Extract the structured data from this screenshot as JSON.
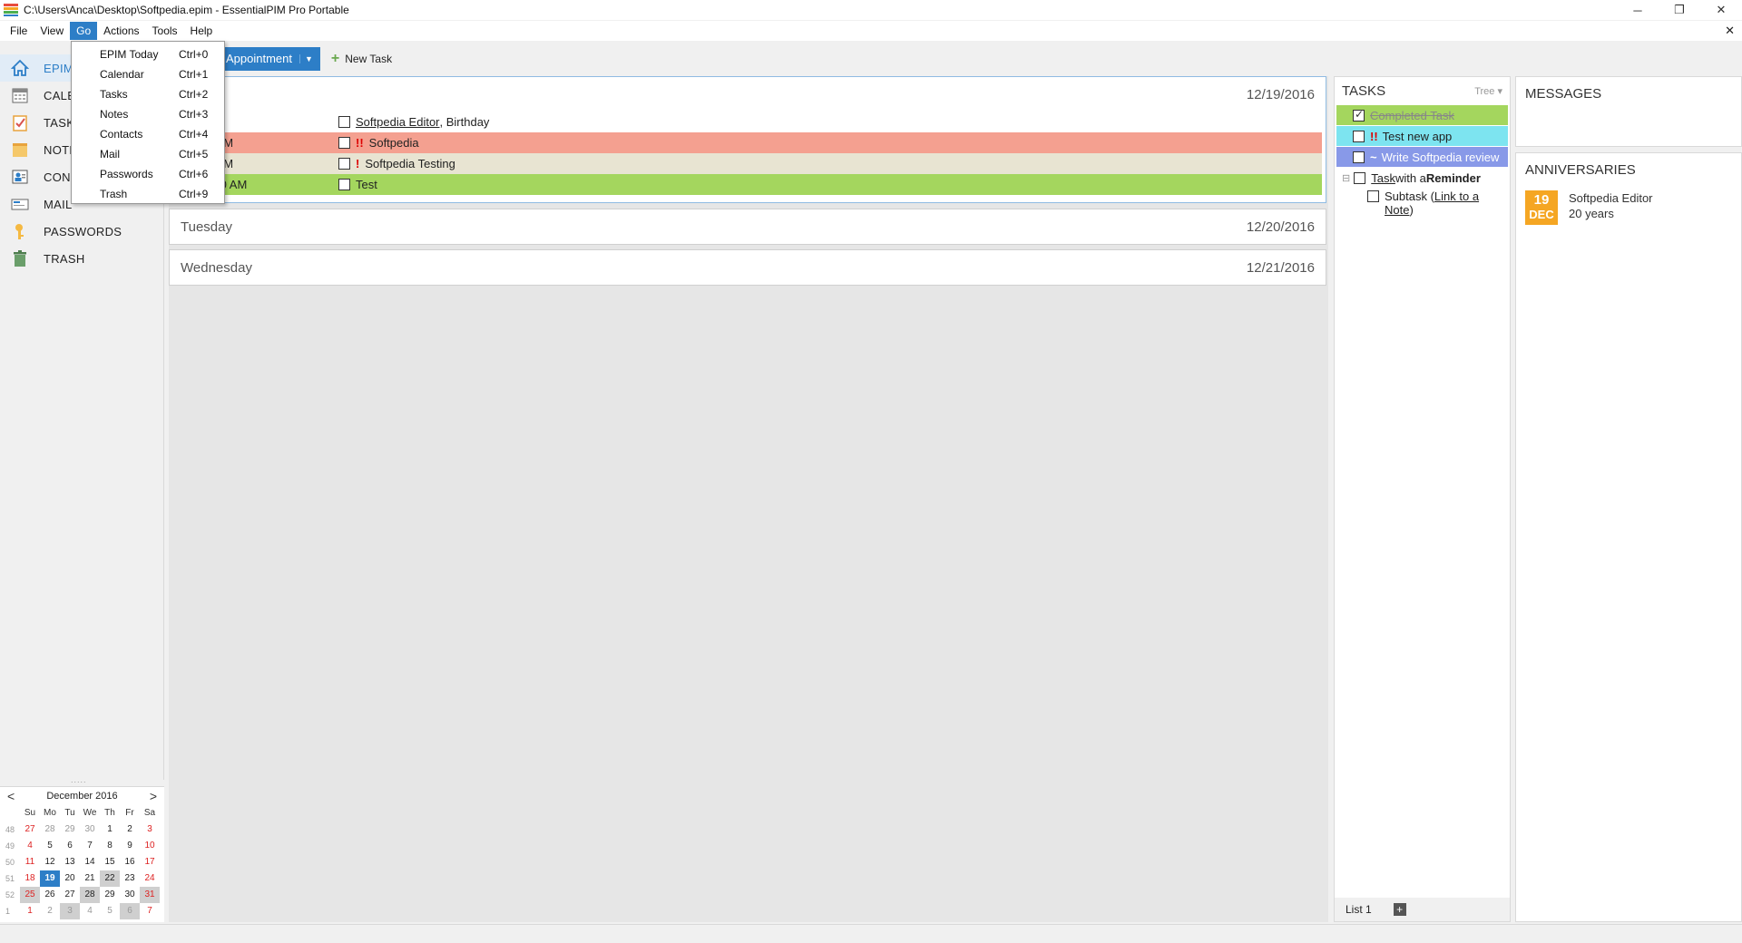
{
  "window": {
    "title": "C:\\Users\\Anca\\Desktop\\Softpedia.epim - EssentialPIM Pro Portable",
    "minimize": "─",
    "restore": "❐",
    "close": "✕",
    "doc_close": "✕"
  },
  "menu": {
    "items": [
      "File",
      "View",
      "Go",
      "Actions",
      "Tools",
      "Help"
    ],
    "active": "Go"
  },
  "go_menu": [
    {
      "label": "EPIM Today",
      "shortcut": "Ctrl+0"
    },
    {
      "label": "Calendar",
      "shortcut": "Ctrl+1"
    },
    {
      "label": "Tasks",
      "shortcut": "Ctrl+2"
    },
    {
      "label": "Notes",
      "shortcut": "Ctrl+3"
    },
    {
      "label": "Contacts",
      "shortcut": "Ctrl+4"
    },
    {
      "label": "Mail",
      "shortcut": "Ctrl+5"
    },
    {
      "label": "Passwords",
      "shortcut": "Ctrl+6"
    },
    {
      "label": "Trash",
      "shortcut": "Ctrl+9"
    }
  ],
  "toolbar": {
    "appointment": "Appointment",
    "new_task": "New Task"
  },
  "sidebar": {
    "items": [
      {
        "label": "EPIM",
        "icon": "home-icon"
      },
      {
        "label": "CALE",
        "icon": "calendar-icon"
      },
      {
        "label": "TASK",
        "icon": "tasks-icon"
      },
      {
        "label": "NOTE",
        "icon": "notes-icon"
      },
      {
        "label": "CONT",
        "icon": "contacts-icon"
      },
      {
        "label": "MAIL",
        "icon": "mail-icon"
      },
      {
        "label": "PASSWORDS",
        "icon": "key-icon"
      },
      {
        "label": "TRASH",
        "icon": "trash-icon"
      }
    ],
    "splitter": "....."
  },
  "mini_calendar": {
    "month_label": "December  2016",
    "weekday_headers": [
      "Su",
      "Mo",
      "Tu",
      "We",
      "Th",
      "Fr",
      "Sa"
    ],
    "weeks": [
      {
        "wk": "48",
        "days": [
          "27",
          "28",
          "29",
          "30",
          "1",
          "2",
          "3"
        ]
      },
      {
        "wk": "49",
        "days": [
          "4",
          "5",
          "6",
          "7",
          "8",
          "9",
          "10"
        ]
      },
      {
        "wk": "50",
        "days": [
          "11",
          "12",
          "13",
          "14",
          "15",
          "16",
          "17"
        ]
      },
      {
        "wk": "51",
        "days": [
          "18",
          "19",
          "20",
          "21",
          "22",
          "23",
          "24"
        ]
      },
      {
        "wk": "52",
        "days": [
          "25",
          "26",
          "27",
          "28",
          "29",
          "30",
          "31"
        ]
      },
      {
        "wk": "1",
        "days": [
          "1",
          "2",
          "3",
          "4",
          "5",
          "6",
          "7"
        ]
      }
    ],
    "prev": "<",
    "next": ">"
  },
  "schedule": {
    "days": [
      {
        "name": "",
        "date": "12/19/2016",
        "events": [
          {
            "time": "event",
            "prio": "",
            "title": "Softpedia Editor",
            "suffix": ", Birthday",
            "underline": true,
            "color": "#ffffff"
          },
          {
            "time": "l - 9:50 AM",
            "prio": "!!",
            "title": "Softpedia",
            "suffix": "",
            "underline": false,
            "color": "#f4a090"
          },
          {
            "time": "l - 9:55 AM",
            "prio": "!",
            "title": "Softpedia Testing",
            "suffix": "",
            "underline": false,
            "color": "#e8e4d2"
          },
          {
            "time": "M - 10:50 AM",
            "prio": "",
            "title": "Test",
            "suffix": "",
            "underline": false,
            "color": "#a4d65e"
          }
        ]
      },
      {
        "name": "Tuesday",
        "date": "12/20/2016",
        "events": []
      },
      {
        "name": "Wednesday",
        "date": "12/21/2016",
        "events": []
      }
    ]
  },
  "tasks": {
    "title": "TASKS",
    "view": "Tree",
    "footer_tab": "List 1",
    "add": "+",
    "expander": "⊟",
    "items": [
      {
        "label": "Completed Task",
        "style": "done"
      },
      {
        "label": "Test new app",
        "prio": "!!",
        "style": "cyan"
      },
      {
        "label": "Write Softpedia review",
        "prio": "~",
        "style": "blue"
      }
    ],
    "reminder_task": {
      "a": "Task",
      "b": " with a ",
      "c": "Reminder"
    },
    "subtask": {
      "a": "Subtask (",
      "b": "Link to a",
      "c": "Note",
      "d": ")"
    }
  },
  "messages": {
    "title": "MESSAGES"
  },
  "anniversaries": {
    "title": "ANNIVERSARIES",
    "items": [
      {
        "day": "19",
        "month": "DEC",
        "name": "Softpedia Editor",
        "detail": "20 years"
      }
    ]
  },
  "colors": {
    "accent": "#2d7ec7",
    "done": "#a4d65e",
    "high": "#f4a090",
    "cyan": "#7de4f0",
    "review": "#8899e8",
    "anniv": "#f5a623"
  }
}
